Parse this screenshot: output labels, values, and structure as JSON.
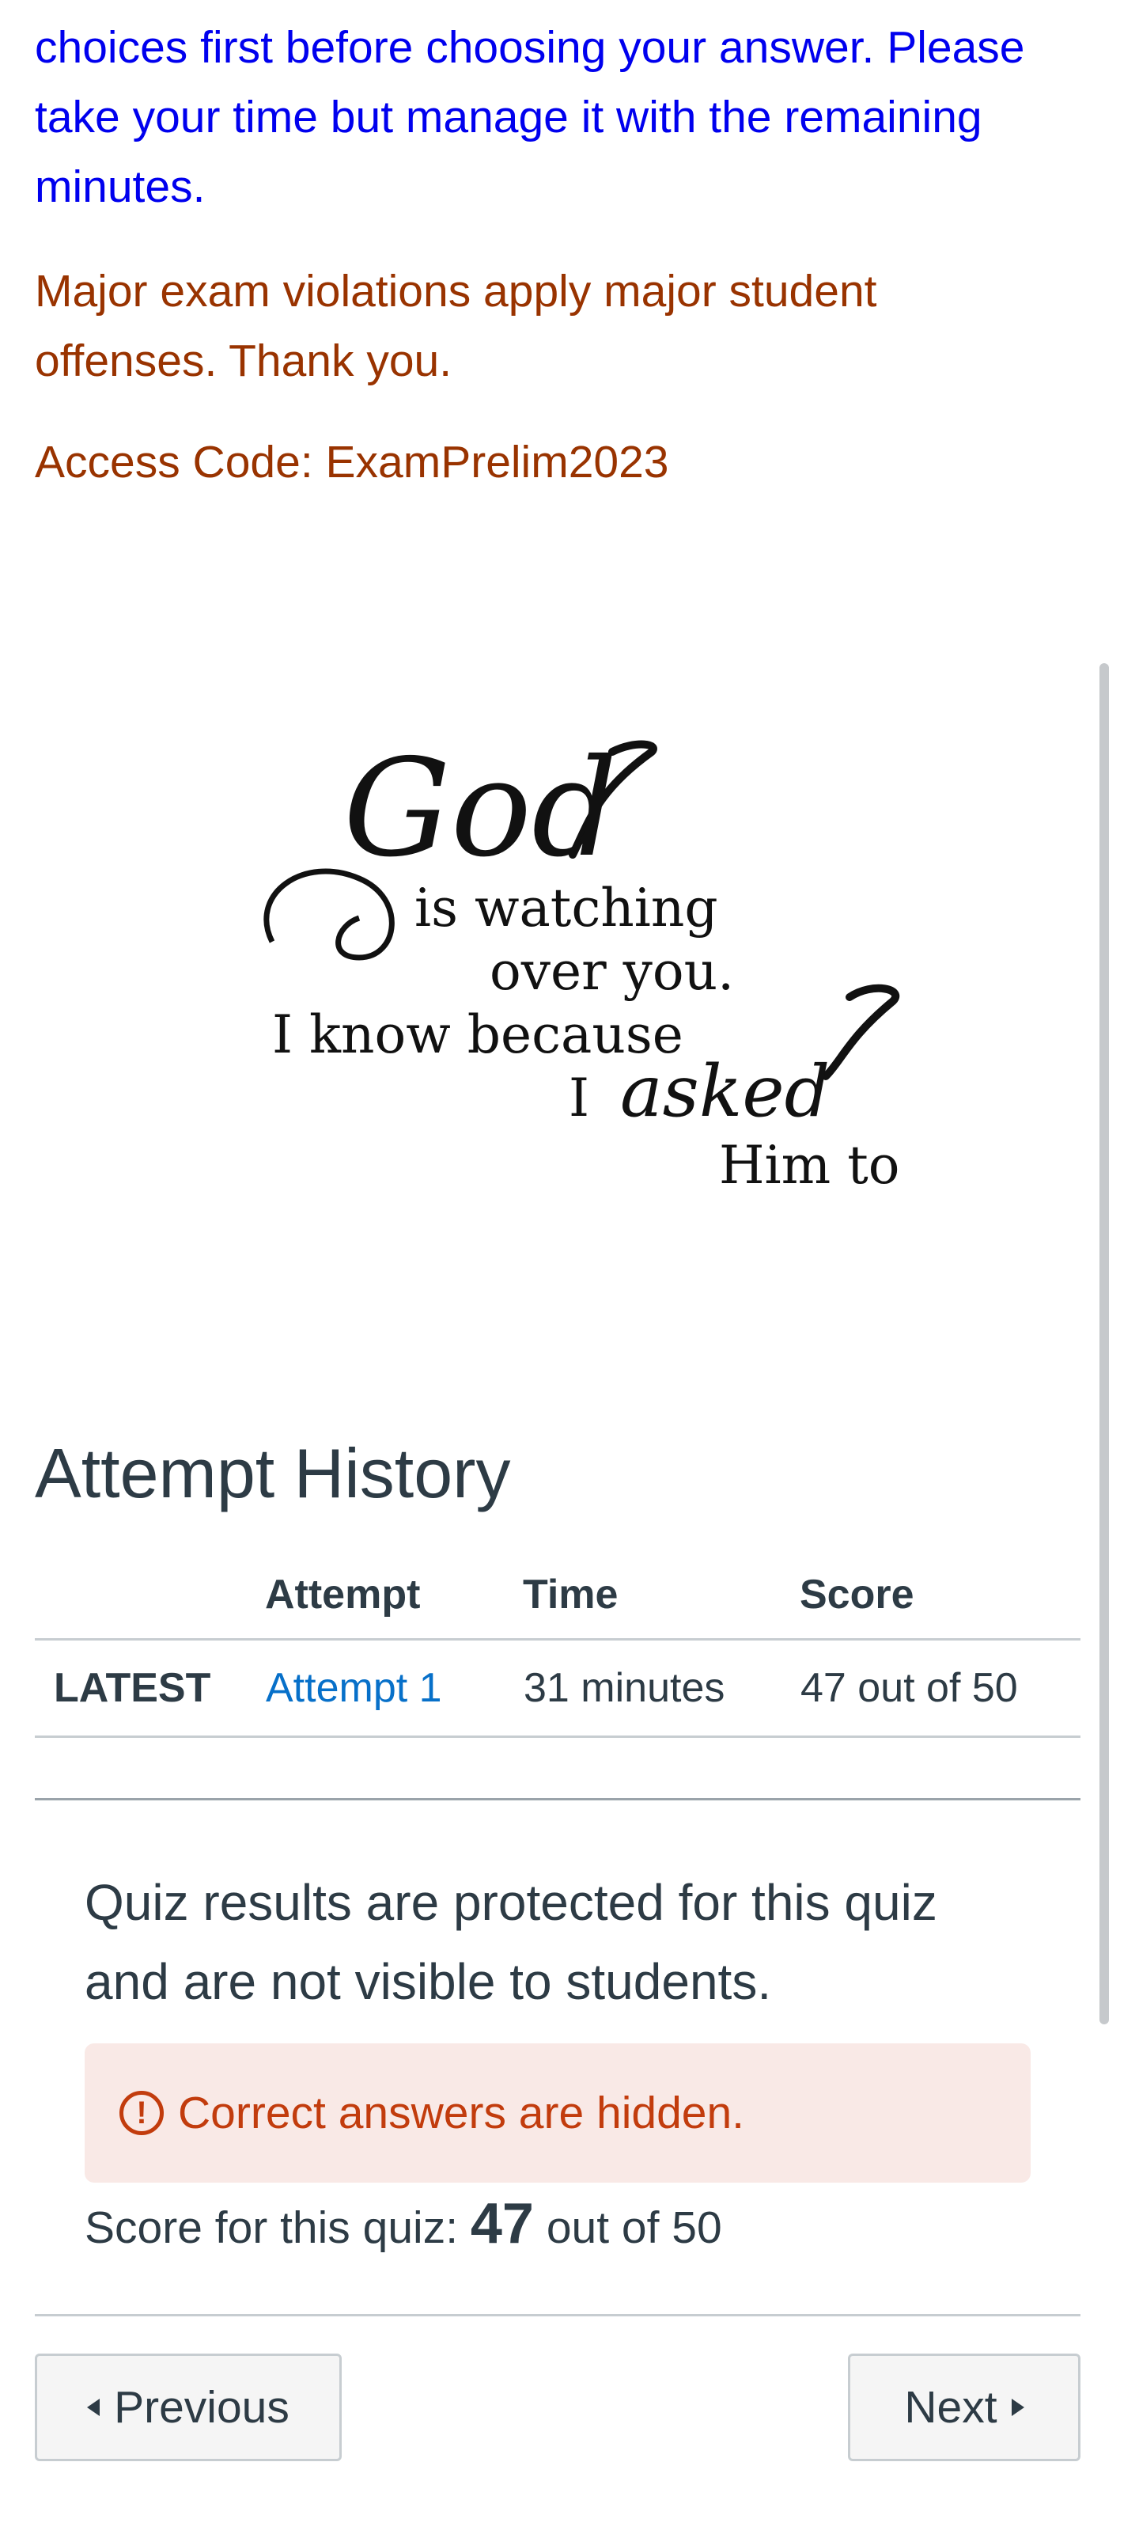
{
  "instructions": {
    "line_blue": "choices first before choosing your answer. Please take your time but manage it with the remaining minutes.",
    "line_violations": "Major exam violations apply major student offenses. Thank you.",
    "access_code": "Access Code: ExamPrelim2023"
  },
  "quote_image": {
    "line1_script": "God",
    "line2": "is watching",
    "line3": "over you.",
    "line4": "I know because",
    "line5_prefix": "I",
    "line5_script": "asked",
    "line6": "Him to"
  },
  "attempt_history": {
    "title": "Attempt History",
    "columns": [
      "",
      "Attempt",
      "Time",
      "Score"
    ],
    "rows": [
      {
        "label": "LATEST",
        "attempt": "Attempt 1",
        "time": "31 minutes",
        "score": "47 out of 50"
      }
    ]
  },
  "results": {
    "protected_message": "Quiz results are protected for this quiz and are not visible to students.",
    "alert_icon": "exclamation-circle-icon",
    "alert_text": "Correct answers are hidden.",
    "score_prefix": "Score for this quiz:",
    "score_value": "47",
    "score_suffix": "out of 50"
  },
  "nav": {
    "previous_label": "Previous",
    "next_label": "Next"
  },
  "colors": {
    "blue_text": "#0000ee",
    "red_text": "#993300",
    "link": "#0770c9",
    "alert_bg": "#f9e9e6",
    "alert_fg": "#c23c0d"
  }
}
